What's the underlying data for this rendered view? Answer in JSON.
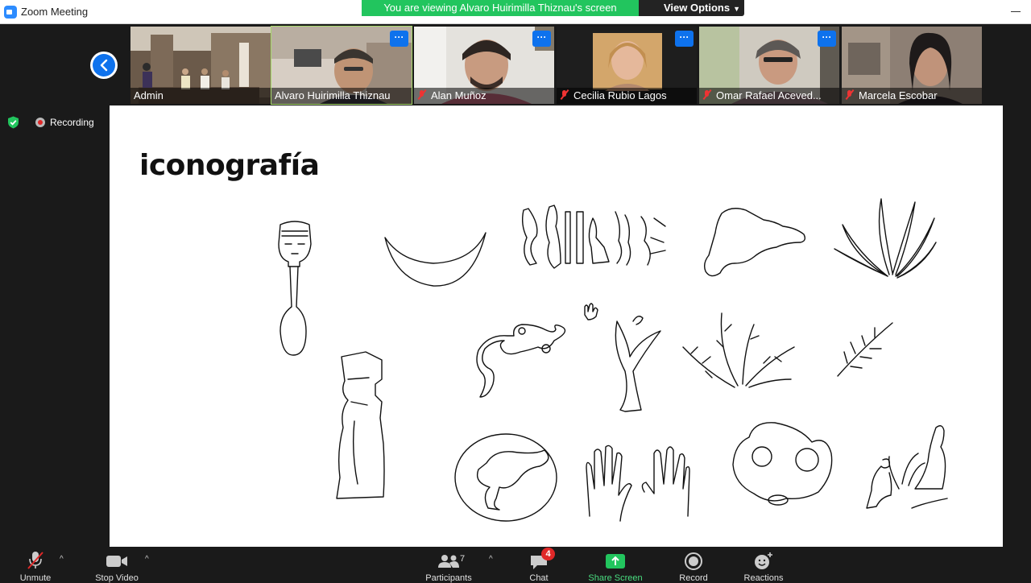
{
  "window": {
    "title": "Zoom Meeting",
    "app_icon": "zoom-icon"
  },
  "banner": {
    "text": "You are viewing Alvaro Huirimilla Thiznau's screen",
    "view_options_label": "View Options",
    "color": "#22c55e"
  },
  "gallery": {
    "participants": [
      {
        "name": "Admin",
        "muted": false,
        "active": false
      },
      {
        "name": "Alvaro Huirimilla Thiznau",
        "muted": false,
        "active": true
      },
      {
        "name": "Alan Muñoz",
        "muted": true,
        "active": false
      },
      {
        "name": "Cecilia Rubio Lagos",
        "muted": true,
        "active": false
      },
      {
        "name": "Omar Rafael Aceved...",
        "muted": true,
        "active": false
      },
      {
        "name": "Marcela Escobar",
        "muted": true,
        "active": false
      }
    ],
    "more_label": "···"
  },
  "status": {
    "recording_label": "Recording",
    "security_icon": "shield-check-icon"
  },
  "slide": {
    "title": "iconografía"
  },
  "toolbar": {
    "unmute_label": "Unmute",
    "stop_video_label": "Stop Video",
    "participants_count": "7",
    "participants_label": "Participants",
    "chat_label": "Chat",
    "chat_badge": "4",
    "share_screen_label": "Share Screen",
    "record_label": "Record",
    "reactions_label": "Reactions",
    "caret": "^"
  },
  "colors": {
    "accent": "#0e72ed",
    "share_green": "#22c55e",
    "alert_red": "#e02828"
  }
}
